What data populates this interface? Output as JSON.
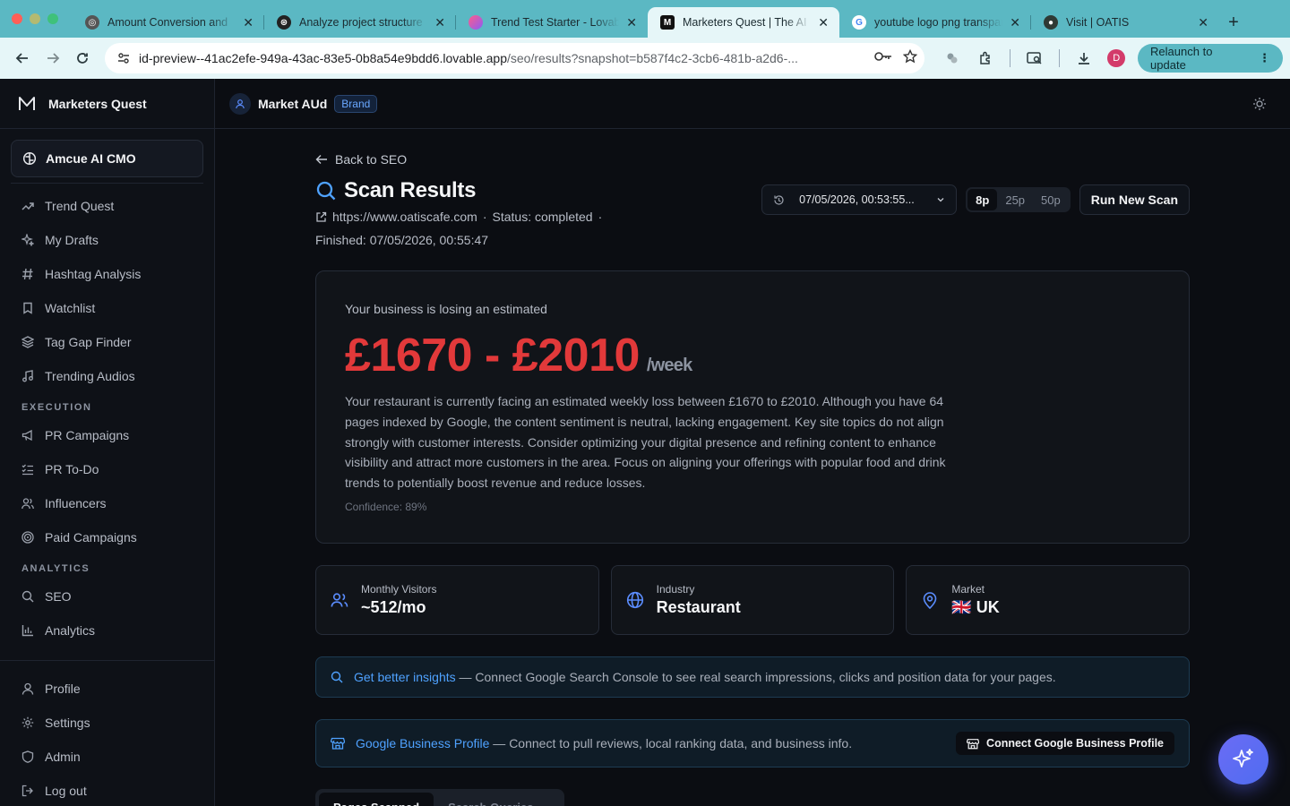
{
  "browser": {
    "tabs": [
      {
        "title": "Amount Conversion and",
        "favicon": "globe-icon"
      },
      {
        "title": "Analyze project structure",
        "favicon": "openai-icon"
      },
      {
        "title": "Trend Test Starter - Lovable",
        "favicon": "lovable-icon"
      },
      {
        "title": "Marketers Quest | The AI",
        "favicon": "marketers-quest-icon",
        "active": true
      },
      {
        "title": "youtube logo png transparent",
        "favicon": "google-icon"
      },
      {
        "title": "Visit | OATIS",
        "favicon": "oatis-icon"
      }
    ],
    "url_host": "id-preview--41ac2efe-949a-43ac-83e5-0b8a54e9bdd6.lovable.app",
    "url_path": "/seo/results?snapshot=b587f4c2-3cb6-481b-a2d6-...",
    "profile_initial": "D",
    "relaunch_label": "Relaunch to update"
  },
  "app": {
    "brand": "Marketers Quest",
    "cmo_label": "Amcue AI CMO",
    "nav_main": [
      {
        "label": "Trend Quest",
        "icon": "trending-icon"
      },
      {
        "label": "My Drafts",
        "icon": "sparkles-icon"
      },
      {
        "label": "Hashtag Analysis",
        "icon": "hash-icon"
      },
      {
        "label": "Watchlist",
        "icon": "bookmark-icon"
      },
      {
        "label": "Tag Gap Finder",
        "icon": "layers-icon"
      },
      {
        "label": "Trending Audios",
        "icon": "music-icon"
      }
    ],
    "section_execution": "EXECUTION",
    "nav_execution": [
      {
        "label": "PR Campaigns",
        "icon": "megaphone-icon"
      },
      {
        "label": "PR To-Do",
        "icon": "list-check-icon"
      },
      {
        "label": "Influencers",
        "icon": "users-icon"
      },
      {
        "label": "Paid Campaigns",
        "icon": "target-icon"
      }
    ],
    "section_analytics": "ANALYTICS",
    "nav_analytics": [
      {
        "label": "SEO",
        "icon": "search-icon"
      },
      {
        "label": "Analytics",
        "icon": "bar-chart-icon"
      }
    ],
    "nav_bottom": [
      {
        "label": "Profile",
        "icon": "user-icon"
      },
      {
        "label": "Settings",
        "icon": "gear-icon"
      },
      {
        "label": "Admin",
        "icon": "shield-icon"
      },
      {
        "label": "Log out",
        "icon": "logout-icon"
      }
    ],
    "workspace": {
      "name": "Market AUd",
      "badge": "Brand"
    }
  },
  "page": {
    "back_label": "Back to SEO",
    "title": "Scan Results",
    "site_url": "https://www.oatiscafe.com",
    "status": "Status: completed",
    "finished": "Finished: 07/05/2026, 00:55:47",
    "snapshot_date": "07/05/2026, 00:53:55...",
    "page_options": [
      "8p",
      "25p",
      "50p"
    ],
    "page_selected": "8p",
    "run_button": "Run New Scan",
    "loss": {
      "lead": "Your business is losing an estimated",
      "amount": "£1670 - £2010",
      "per": "/week",
      "description": "Your restaurant is currently facing an estimated weekly loss between £1670 to £2010. Although you have 64 pages indexed by Google, the content sentiment is neutral, lacking engagement. Key site topics do not align strongly with customer interests. Consider optimizing your digital presence and refining content to enhance visibility and attract more customers in the area. Focus on aligning your offerings with popular food and drink trends to potentially boost revenue and reduce losses.",
      "confidence": "Confidence: 89%"
    },
    "stats": [
      {
        "label": "Monthly Visitors",
        "value": "~512/mo",
        "icon": "users-icon"
      },
      {
        "label": "Industry",
        "value": "Restaurant",
        "icon": "globe-icon"
      },
      {
        "label": "Market",
        "value": "🇬🇧 UK",
        "icon": "map-pin-icon"
      }
    ],
    "insights_banner": {
      "link": "Get better insights",
      "text": " — Connect Google Search Console to see real search impressions, clicks and position data for your pages."
    },
    "gbp_banner": {
      "link": "Google Business Profile",
      "text": " — Connect to pull reviews, local ranking data, and business info.",
      "button": "Connect Google Business Profile"
    },
    "result_tabs": [
      "Pages Scanned",
      "Search Queries"
    ],
    "result_tab_selected": "Pages Scanned"
  },
  "colors": {
    "accent": "#4fa2ff",
    "loss": "#e2393a",
    "browser": "#5bb8c3"
  }
}
